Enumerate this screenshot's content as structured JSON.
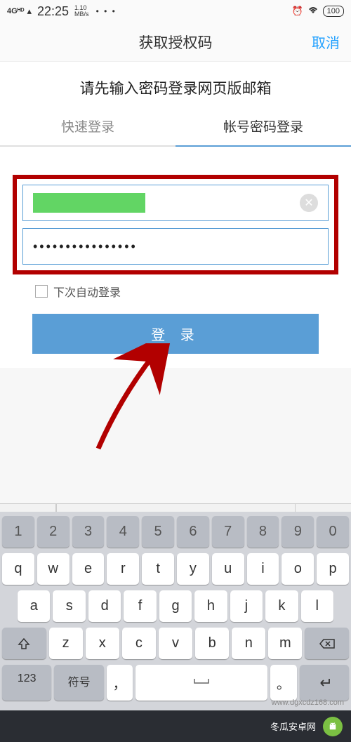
{
  "status": {
    "network": "4Gᴴᴰ",
    "time": "22:25",
    "speed_top": "1.10",
    "speed_bottom": "MB/s",
    "dots": "• • •",
    "battery": "100"
  },
  "nav": {
    "title": "获取授权码",
    "cancel": "取消"
  },
  "instruction": "请先输入密码登录网页版邮箱",
  "tabs": {
    "quick": "快速登录",
    "password": "帐号密码登录"
  },
  "form": {
    "password_mask": "••••••••••••••••",
    "auto_login": "下次自动登录",
    "login_button": "登 录"
  },
  "keyboard": {
    "numbers": [
      "1",
      "2",
      "3",
      "4",
      "5",
      "6",
      "7",
      "8",
      "9",
      "0"
    ],
    "row1": [
      "q",
      "w",
      "e",
      "r",
      "t",
      "y",
      "u",
      "i",
      "o",
      "p"
    ],
    "row2": [
      "a",
      "s",
      "d",
      "f",
      "g",
      "h",
      "j",
      "k",
      "l"
    ],
    "row3": [
      "z",
      "x",
      "c",
      "v",
      "b",
      "n",
      "m"
    ],
    "key_123": "123",
    "key_symbol": "符号",
    "key_comma": "，",
    "key_period": "。"
  },
  "watermark": {
    "text": "冬瓜安卓网",
    "url": "www.dgxcdz168.com"
  }
}
